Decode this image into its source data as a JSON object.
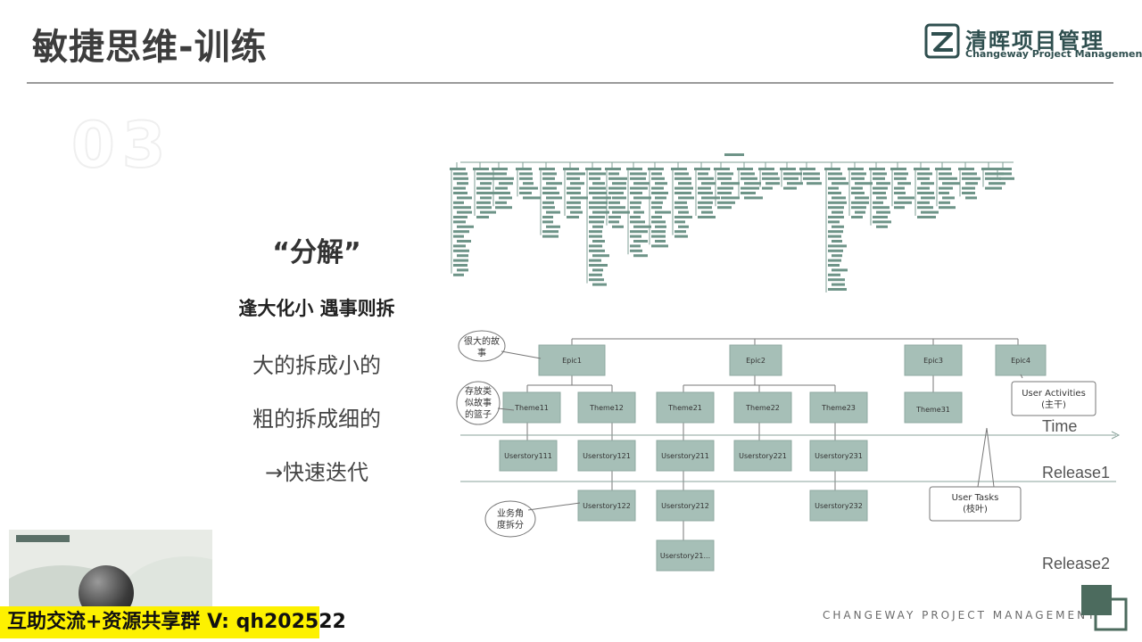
{
  "header": {
    "title": "敏捷思维-训练",
    "logo_cn": "清晖项目管理",
    "logo_en": "Changeway Project Management"
  },
  "section_number": "03",
  "left": {
    "heading": "“分解”",
    "subheading": "逢大化小 遇事则拆",
    "bullets": [
      "大的拆成小的",
      "粗的拆成细的",
      "→快速迭代"
    ]
  },
  "diagram": {
    "epics": [
      "Epic1",
      "Epic2",
      "Epic3",
      "Epic4"
    ],
    "themes": [
      "Theme11",
      "Theme12",
      "Theme21",
      "Theme22",
      "Theme23",
      "Theme31"
    ],
    "stories_row1": [
      "Userstory111",
      "Userstory121",
      "Userstory211",
      "Userstory221",
      "Userstory231"
    ],
    "stories_row2": [
      "Userstory122",
      "Userstory212",
      "Userstory232"
    ],
    "stories_row3": [
      "Userstory21..."
    ],
    "callouts": {
      "big_story": [
        "很大的故",
        "事"
      ],
      "theme_box": [
        "存放类",
        "似故事",
        "的篮子"
      ],
      "business": [
        "业务角",
        "度拆分"
      ],
      "user_activities": [
        "User Activities",
        "(主干)"
      ],
      "user_tasks": [
        "User Tasks",
        "(枝叶)"
      ]
    },
    "labels": {
      "time": "Time",
      "release1": "Release1",
      "release2": "Release2"
    }
  },
  "watermark": "互助交流+资源共享群 V: qh202522",
  "footer": "CHANGEWAY PROJECT MANAGEMENT",
  "colors": {
    "node_fill": "#a6bfb7",
    "title_text": "#3d3d3d",
    "watermark_bg": "#fdf100",
    "logo": "#2f4f4f"
  }
}
